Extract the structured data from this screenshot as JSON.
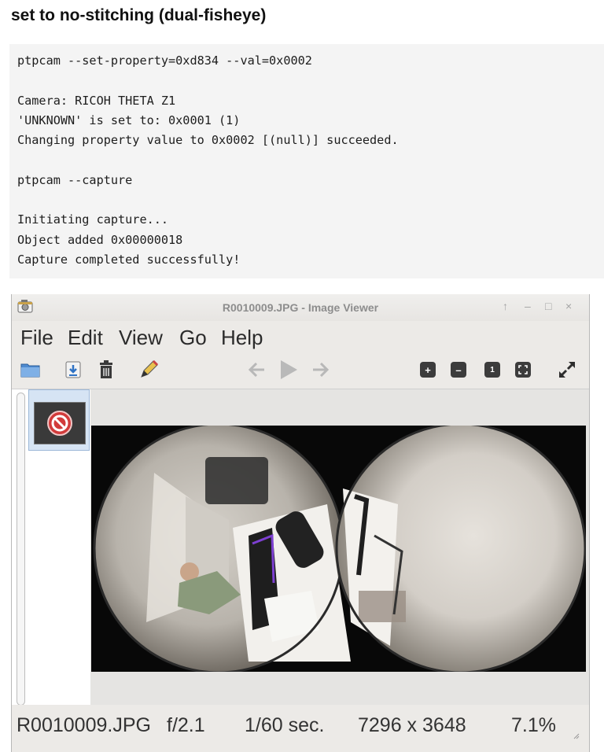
{
  "heading": "set to no-stitching (dual-fisheye)",
  "code_lines": [
    "ptpcam --set-property=0xd834 --val=0x0002",
    "",
    "Camera: RICOH THETA Z1",
    "'UNKNOWN' is set to: 0x0001 (1)",
    "Changing property value to 0x0002 [(null)] succeeded.",
    "",
    "ptpcam --capture",
    "",
    "Initiating capture...",
    "Object added 0x00000018",
    "Capture completed successfully!"
  ],
  "viewer": {
    "title": "R0010009.JPG - Image Viewer",
    "titlebar_buttons": [
      "↑",
      "–",
      "□",
      "×"
    ],
    "menu": [
      "File",
      "Edit",
      "View",
      "Go",
      "Help"
    ],
    "toolbar_icons": [
      "open-folder-icon",
      "save-icon",
      "trash-icon",
      "edit-pencil-icon",
      "back-arrow-icon",
      "play-icon",
      "forward-arrow-icon",
      "zoom-in-icon",
      "zoom-out-icon",
      "actual-size-icon",
      "fit-window-icon",
      "fullscreen-icon"
    ],
    "zoom_labels": {
      "zoom_in": "+",
      "zoom_out": "–",
      "actual_size": "1"
    },
    "status": {
      "filename": "R0010009.JPG",
      "aperture": "f/2.1",
      "shutter": "1/60 sec.",
      "resolution": "7296 x 3648",
      "zoom": "7.1%"
    }
  },
  "colors": {
    "code_bg": "#f4f4f4",
    "viewer_bg": "#eceae7",
    "selection": "#d6e4f4",
    "no_entry_red": "#d23b3b"
  }
}
